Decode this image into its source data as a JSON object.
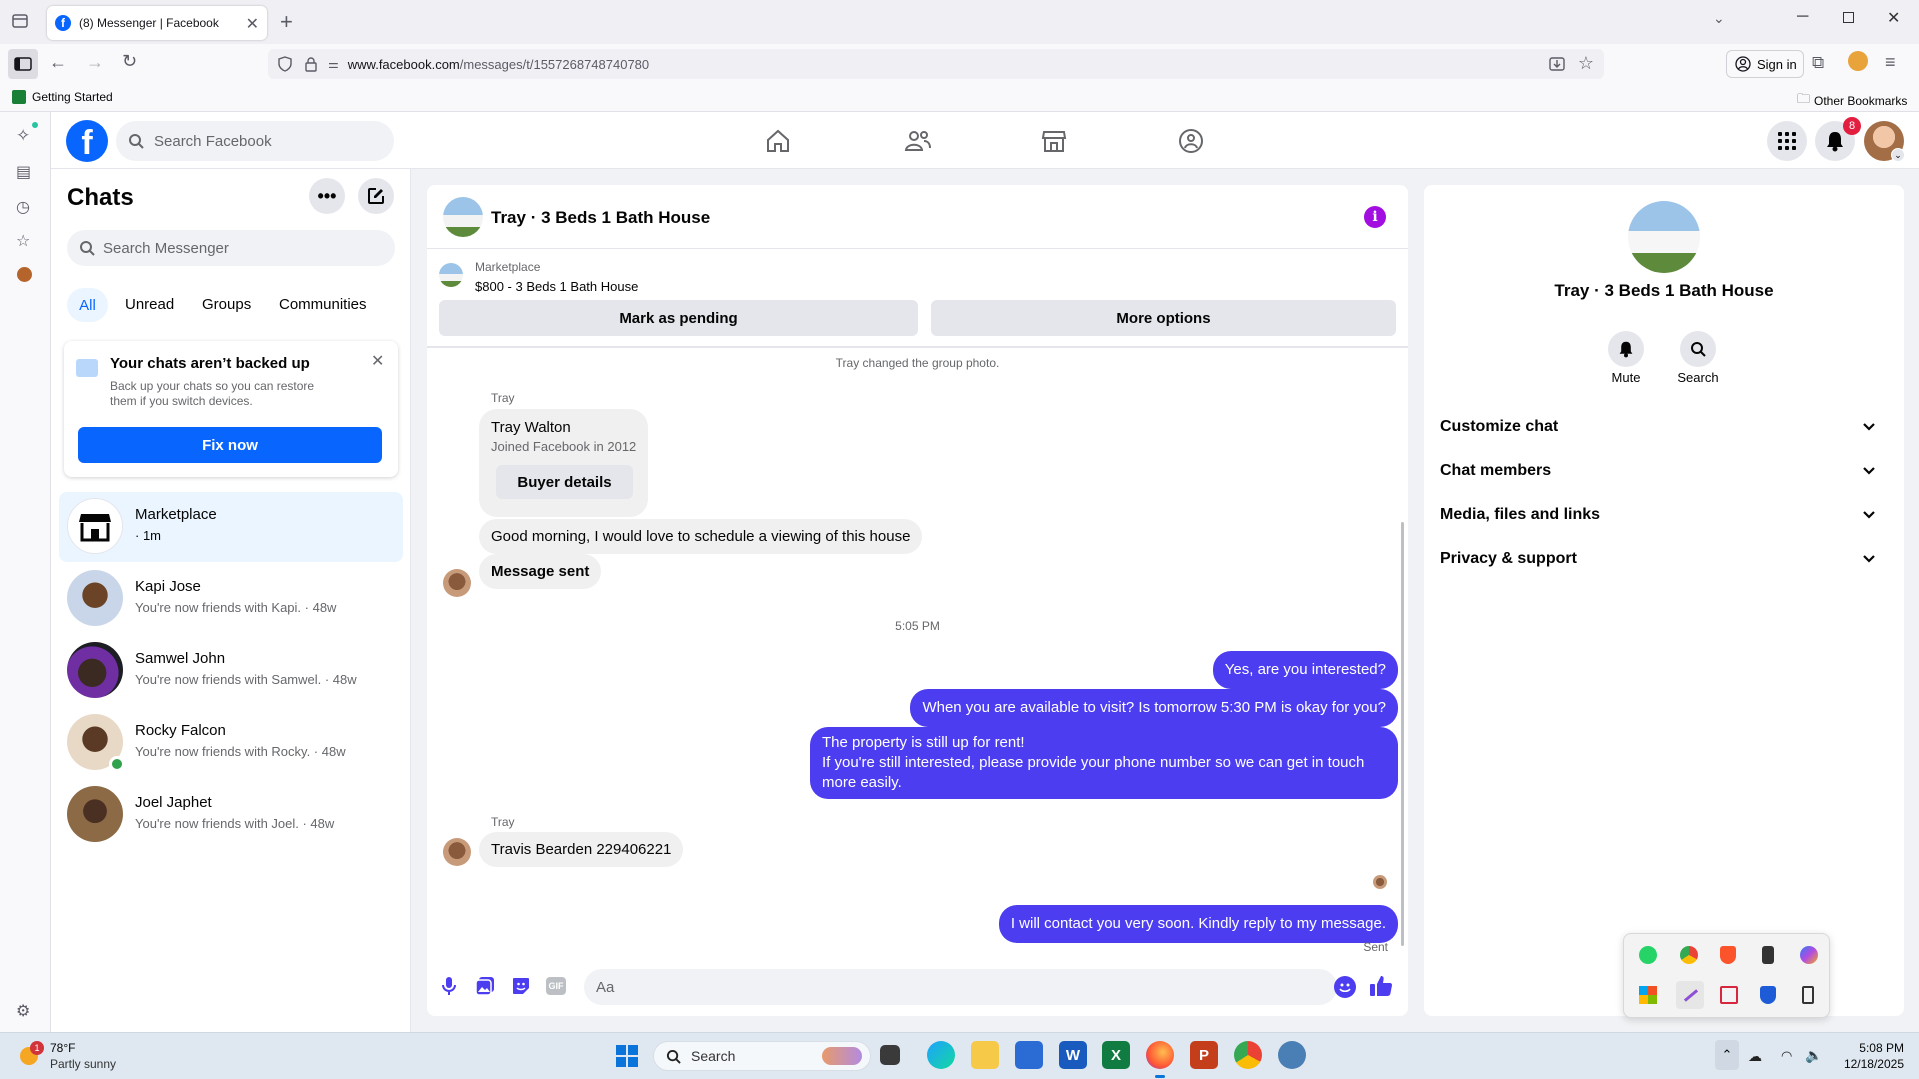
{
  "browser": {
    "tab_title": "(8) Messenger | Facebook",
    "url_domain": "www.facebook.com",
    "url_path": "/messages/t/1557268748740780",
    "sign_in": "Sign in",
    "bookmark_getting_started": "Getting Started",
    "bookmark_other": "Other Bookmarks"
  },
  "fb_header": {
    "search_placeholder": "Search Facebook",
    "notification_count": "8",
    "brand_color": "#0866ff"
  },
  "chats": {
    "title": "Chats",
    "search_placeholder": "Search Messenger",
    "filters": [
      "All",
      "Unread",
      "Groups",
      "Communities"
    ],
    "backup": {
      "title": "Your chats aren’t backed up",
      "line1": "Back up your chats so you can restore",
      "line2": "them if you switch devices.",
      "button": "Fix now"
    },
    "items": [
      {
        "name": "Marketplace",
        "sub": "· 1m"
      },
      {
        "name": "Kapi Jose",
        "sub": "You're now friends with Kapi. · 48w"
      },
      {
        "name": "Samwel John",
        "sub": "You're now friends with Samwel. · 48w"
      },
      {
        "name": "Rocky Falcon",
        "sub": "You're now friends with Rocky. · 48w"
      },
      {
        "name": "Joel Japhet",
        "sub": "You're now friends with Joel. · 48w"
      }
    ]
  },
  "conversation": {
    "title": "Tray · 3 Beds 1 Bath House",
    "marketplace_label": "Marketplace",
    "listing": "$800 - 3 Beds 1 Bath House",
    "mark_pending": "Mark as pending",
    "more_options": "More options",
    "system_msg": "Tray changed the group photo.",
    "sender_label": "Tray",
    "card_name": "Tray Walton",
    "card_joined": "Joined Facebook in 2012",
    "card_button": "Buyer details",
    "msg1": "Good morning, I would love to schedule a viewing of this house",
    "msg2": "Message sent",
    "time_sep": "5:05 PM",
    "out1": "Yes, are you interested?",
    "out2": "When you are available to visit? Is tomorrow 5:30 PM is okay for you?",
    "out3_line1": "The property is still up for rent!",
    "out3_line2": "If you're still interested, please provide your phone number so we can get in touch",
    "out3_line3": "more easily.",
    "sender_label2": "Tray",
    "msg3": "Travis Bearden 229406221",
    "out4": "I will contact you very soon. Kindly reply to my message.",
    "sent_status": "Sent",
    "composer_placeholder": "Aa",
    "accent": "#4c3df0"
  },
  "info_panel": {
    "name": "Tray · 3 Beds 1 Bath House",
    "mute": "Mute",
    "search": "Search",
    "sections": [
      "Customize chat",
      "Chat members",
      "Media, files and links",
      "Privacy & support"
    ]
  },
  "taskbar": {
    "weather_temp": "78°F",
    "weather_desc": "Partly sunny",
    "weather_badge": "1",
    "search": "Search",
    "time": "5:08 PM",
    "date": "12/18/2025"
  }
}
